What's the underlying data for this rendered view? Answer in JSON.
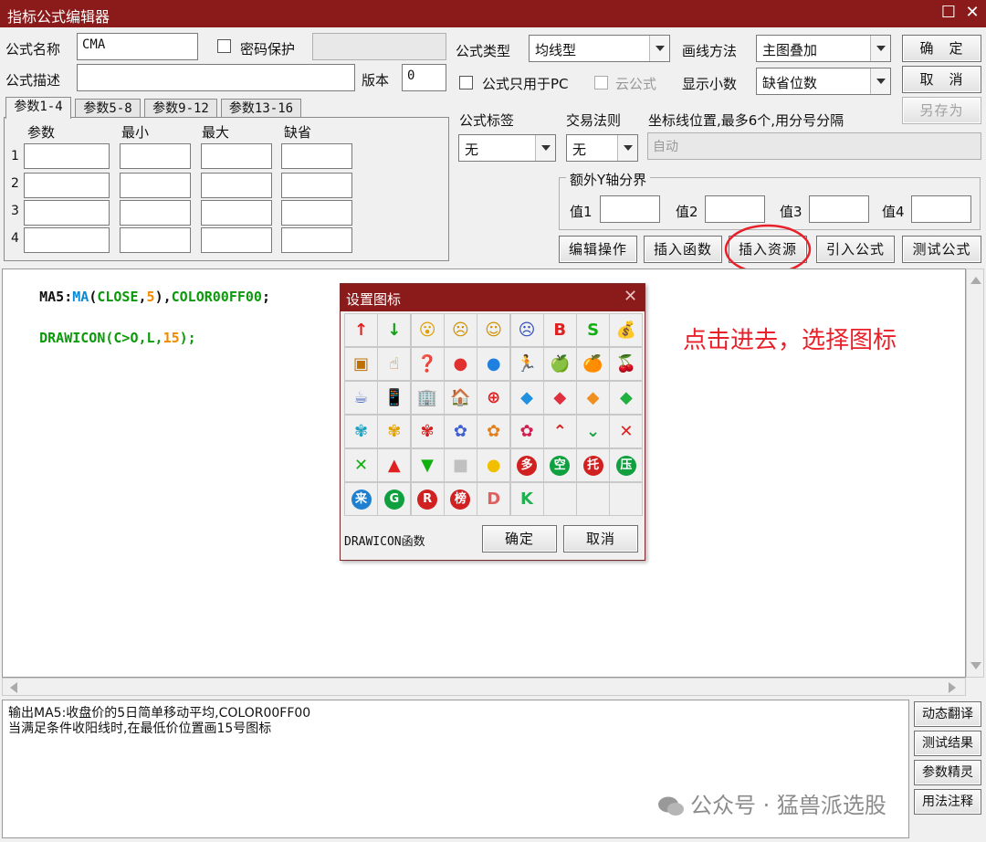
{
  "window": {
    "title": "指标公式编辑器",
    "max_glyph": "☐",
    "close_glyph": "✕"
  },
  "form": {
    "name_label": "公式名称",
    "name_value": "CMA",
    "password_label": "密码保护",
    "desc_label": "公式描述",
    "desc_value": "",
    "version_label": "版本",
    "version_value": "0",
    "type_label": "公式类型",
    "type_value": "均线型",
    "draw_label": "画线方法",
    "draw_value": "主图叠加",
    "pc_only_label": "公式只用于PC",
    "cloud_label": "云公式",
    "decimal_label": "显示小数",
    "decimal_value": "缺省位数",
    "tag_label": "公式标签",
    "tag_value": "无",
    "trade_label": "交易法则",
    "trade_value": "无",
    "coord_label": "坐标线位置,最多6个,用分号分隔",
    "coord_value": "自动",
    "extra_y_label": "额外Y轴分界",
    "v1_label": "值1",
    "v2_label": "值2",
    "v3_label": "值3",
    "v4_label": "值4"
  },
  "buttons": {
    "ok": "确　定",
    "cancel": "取　消",
    "save_as": "另存为",
    "edit_ops": "编辑操作",
    "insert_func": "插入函数",
    "insert_res": "插入资源",
    "import_formula": "引入公式",
    "test_formula": "测试公式"
  },
  "params": {
    "tabs": [
      "参数1-4",
      "参数5-8",
      "参数9-12",
      "参数13-16"
    ],
    "headers": [
      "参数",
      "最小",
      "最大",
      "缺省"
    ],
    "rows": [
      "1",
      "2",
      "3",
      "4"
    ]
  },
  "code": {
    "line1": {
      "a": "MA5:",
      "b": "MA",
      "c": "(",
      "d": "CLOSE",
      "e": ",",
      "f": "5",
      "g": "),",
      "h": "COLOR00FF00",
      "i": ";"
    },
    "line2": {
      "a": "DRAWICON",
      "b": "(C>O,L,",
      "c": "15",
      "d": ");"
    }
  },
  "output": {
    "line1": "输出MA5:收盘价的5日简单移动平均,COLOR00FF00",
    "line2": "当满足条件收阳线时,在最低价位置画15号图标"
  },
  "side_buttons": [
    "动态翻译",
    "测试结果",
    "参数精灵",
    "用法注释"
  ],
  "dialog": {
    "title": "设置图标",
    "func_label": "DRAWICON函数",
    "ok": "确定",
    "cancel": "取消",
    "icons": [
      {
        "name": "up-arrow-icon",
        "glyph": "↑",
        "color": "#e02020"
      },
      {
        "name": "down-arrow-icon",
        "glyph": "↓",
        "color": "#10a010"
      },
      {
        "name": "surprised-face-icon",
        "glyph": "😮",
        "color": "#e0a000"
      },
      {
        "name": "sad-face-icon",
        "glyph": "☹",
        "color": "#d09000"
      },
      {
        "name": "smile-face-icon",
        "glyph": "☺",
        "color": "#d09000"
      },
      {
        "name": "blue-sad-face-icon",
        "glyph": "☹",
        "color": "#3050c0"
      },
      {
        "name": "letter-b-icon",
        "glyph": "B",
        "color": "#e02020"
      },
      {
        "name": "letter-s-icon",
        "glyph": "S",
        "color": "#10b010"
      },
      {
        "name": "money-bag-icon",
        "glyph": "💰",
        "color": "#c08000"
      },
      {
        "name": "sign-board-icon",
        "glyph": "▣",
        "color": "#c07000"
      },
      {
        "name": "hand-pointer-icon",
        "glyph": "☝",
        "color": "#d08000"
      },
      {
        "name": "speech-bubble-icon",
        "glyph": "❓",
        "color": "#c07000"
      },
      {
        "name": "red-ball-icon",
        "glyph": "●",
        "color": "#e03030"
      },
      {
        "name": "blue-ball-icon",
        "glyph": "●",
        "color": "#2080e0"
      },
      {
        "name": "running-man-icon",
        "glyph": "🏃",
        "color": "#d07000"
      },
      {
        "name": "green-apple-icon",
        "glyph": "🍏",
        "color": "#50a020"
      },
      {
        "name": "orange-fruit-icon",
        "glyph": "🍊",
        "color": "#f09000"
      },
      {
        "name": "fruit-cluster-icon",
        "glyph": "🍒",
        "color": "#c03030"
      },
      {
        "name": "cup-icon",
        "glyph": "☕",
        "color": "#5070c0"
      },
      {
        "name": "phone-icon",
        "glyph": "📱",
        "color": "#4080d0"
      },
      {
        "name": "building-icon",
        "glyph": "🏢",
        "color": "#4090c0"
      },
      {
        "name": "house-icon",
        "glyph": "🏠",
        "color": "#c04020"
      },
      {
        "name": "red-cross-icon",
        "glyph": "⊕",
        "color": "#e02020"
      },
      {
        "name": "blue-diamond-icon",
        "glyph": "◆",
        "color": "#2090e0"
      },
      {
        "name": "red-diamond-icon",
        "glyph": "◆",
        "color": "#e03040"
      },
      {
        "name": "orange-diamond-icon",
        "glyph": "◆",
        "color": "#f09020"
      },
      {
        "name": "green-diamond-icon",
        "glyph": "◆",
        "color": "#20b040"
      },
      {
        "name": "blue-butterfly-icon",
        "glyph": "✾",
        "color": "#20a0c0"
      },
      {
        "name": "yellow-butterfly-icon",
        "glyph": "✾",
        "color": "#e0a000"
      },
      {
        "name": "red-butterfly-icon",
        "glyph": "✾",
        "color": "#d02020"
      },
      {
        "name": "blue-flower-icon",
        "glyph": "✿",
        "color": "#4060d0"
      },
      {
        "name": "orange-flower-icon",
        "glyph": "✿",
        "color": "#e08020"
      },
      {
        "name": "red-flower-icon",
        "glyph": "✿",
        "color": "#d02050"
      },
      {
        "name": "red-chevron-up-icon",
        "glyph": "⌃",
        "color": "#d02020"
      },
      {
        "name": "green-chevron-down-icon",
        "glyph": "⌄",
        "color": "#10a040"
      },
      {
        "name": "red-x-icon",
        "glyph": "✕",
        "color": "#e02020"
      },
      {
        "name": "green-x-icon",
        "glyph": "✕",
        "color": "#10b010"
      },
      {
        "name": "red-triangle-up-icon",
        "glyph": "▲",
        "color": "#e02020"
      },
      {
        "name": "green-triangle-down-icon",
        "glyph": "▼",
        "color": "#10b010"
      },
      {
        "name": "gray-square-icon",
        "glyph": "■",
        "color": "#c0c0c0"
      },
      {
        "name": "yellow-dot-icon",
        "glyph": "●",
        "color": "#f0c000"
      },
      {
        "name": "duo-badge-icon",
        "glyph": "多",
        "color": "#d02020",
        "circle": true
      },
      {
        "name": "kong-badge-icon",
        "glyph": "空",
        "color": "#10a040",
        "circle": true
      },
      {
        "name": "tuo-badge-icon",
        "glyph": "托",
        "color": "#d02020",
        "circle": true
      },
      {
        "name": "ya-badge-icon",
        "glyph": "压",
        "color": "#10a040",
        "circle": true
      },
      {
        "name": "lai-badge-icon",
        "glyph": "来",
        "color": "#2080d0",
        "circle": true
      },
      {
        "name": "letter-g-badge-icon",
        "glyph": "G",
        "color": "#10a040",
        "circle": true
      },
      {
        "name": "letter-r-badge-icon",
        "glyph": "R",
        "color": "#d02020",
        "circle": true
      },
      {
        "name": "bang-badge-icon",
        "glyph": "榜",
        "color": "#d02020",
        "circle": true
      },
      {
        "name": "letter-d-icon",
        "glyph": "D",
        "color": "#e06060"
      },
      {
        "name": "letter-k-icon",
        "glyph": "K",
        "color": "#20b050"
      },
      {
        "name": "empty-cell",
        "glyph": "",
        "color": "#000"
      },
      {
        "name": "empty-cell",
        "glyph": "",
        "color": "#000"
      },
      {
        "name": "empty-cell",
        "glyph": "",
        "color": "#000"
      }
    ]
  },
  "annotation": "点击进去，选择图标",
  "watermark": "公众号 · 猛兽派选股",
  "colors": {
    "titlebar": "#8b1a1a",
    "annotation": "#e8202a",
    "code_green": "#0a9a0a",
    "code_blue": "#0a8ad6",
    "code_orange": "#f08a00"
  }
}
